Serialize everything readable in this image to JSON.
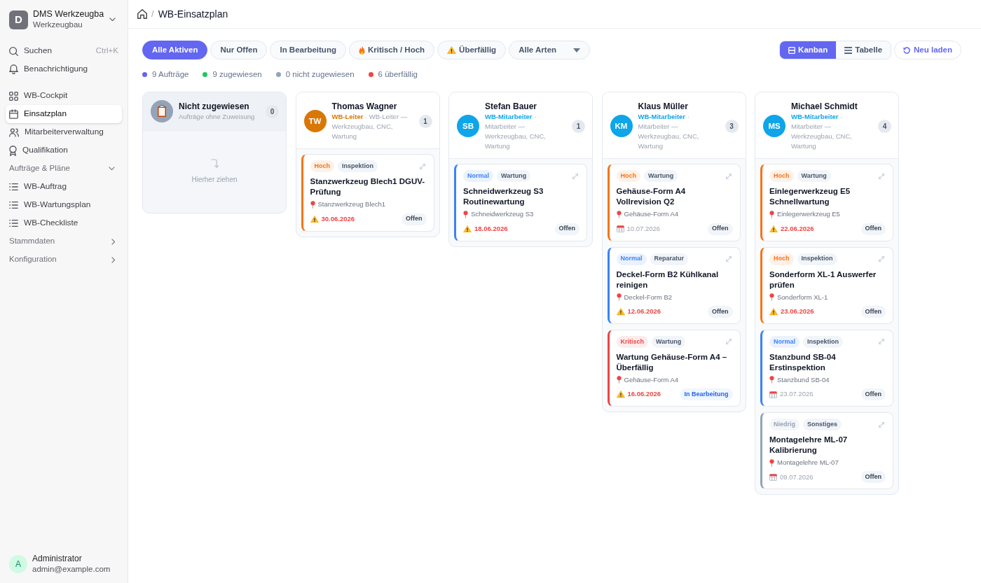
{
  "sidebar": {
    "workspace": {
      "initial": "D",
      "name": "DMS Werkzeugba",
      "subtitle": "Werkzeugbau"
    },
    "search": {
      "label": "Suchen",
      "shortcut": "Ctrl+K"
    },
    "notifications": {
      "label": "Benachrichtigung"
    },
    "nav": [
      {
        "kind": "link",
        "label": "WB-Cockpit",
        "selected": false
      },
      {
        "kind": "link",
        "label": "Einsatzplan",
        "selected": true
      },
      {
        "kind": "link",
        "label": "Mitarbeiterverwaltung",
        "selected": false
      },
      {
        "kind": "link",
        "label": "Qualifikation",
        "selected": false
      },
      {
        "kind": "group",
        "label": "Aufträge & Pläne",
        "expanded": true,
        "children": [
          {
            "kind": "link",
            "label": "WB-Auftrag",
            "selected": false
          },
          {
            "kind": "link",
            "label": "WB-Wartungsplan",
            "selected": false
          },
          {
            "kind": "link",
            "label": "WB-Checkliste",
            "selected": false
          }
        ]
      },
      {
        "kind": "group",
        "label": "Stammdaten",
        "expanded": false
      },
      {
        "kind": "group",
        "label": "Konfiguration",
        "expanded": false
      }
    ],
    "user": {
      "initial": "A",
      "name": "Administrator",
      "email": "admin@example.com"
    }
  },
  "breadcrumb": {
    "separator": "/",
    "current": "WB-Einsatzplan"
  },
  "filters": [
    {
      "label": "Alle Aktiven",
      "selected": true
    },
    {
      "label": "Nur Offen",
      "selected": false
    },
    {
      "label": "In Bearbeitung",
      "selected": false
    },
    {
      "label": "Kritisch / Hoch",
      "selected": false
    },
    {
      "label": "Überfällig",
      "selected": false
    }
  ],
  "type_filter": {
    "value": "Alle Arten"
  },
  "views": [
    {
      "label": "Kanban",
      "selected": true
    },
    {
      "label": "Tabelle",
      "selected": false
    }
  ],
  "reload": {
    "label": "Neu laden"
  },
  "stats": [
    {
      "text": "9 Aufträge",
      "color": "#6366f1"
    },
    {
      "text": "9 zugewiesen",
      "color": "#22c55e"
    },
    {
      "text": "0 nicht zugewiesen",
      "color": "#94a3b8"
    },
    {
      "text": "6 überfällig",
      "color": "#ef4444"
    }
  ],
  "columns": [
    {
      "kind": "unassigned",
      "title": "Nicht zugewiesen",
      "subtitle": "Aufträge ohne Zuweisung",
      "count": "0",
      "empty_hint": "Hierher ziehen"
    },
    {
      "kind": "person",
      "initials": "TW",
      "color": "#d97706",
      "name": "Thomas Wagner",
      "role": "**WB-Leiter** · WB-Leiter — Werkzeugbau, CNC, Wartung",
      "count": "1",
      "cards": [
        {
          "priority": "Hoch",
          "color": "#f97316",
          "type": "Inspektion",
          "title": "Stanzwerkzeug Blech1 DGUV-Prüfung",
          "location": "Stanzwerkzeug Blech1",
          "date": "30.06.2026",
          "overdue": true,
          "status": {
            "label": "Offen",
            "kind": "open"
          }
        }
      ]
    },
    {
      "kind": "person",
      "initials": "SB",
      "color": "#0ea5e9",
      "name": "Stefan Bauer",
      "role": "**WB-Mitarbeiter** · Mitarbeiter — Werkzeugbau, CNC, Wartung",
      "count": "1",
      "cards": [
        {
          "priority": "Normal",
          "color": "#3b82f6",
          "type": "Wartung",
          "title": "Schneidwerkzeug S3 Routinewartung",
          "location": "Schneidwerkzeug S3",
          "date": "18.06.2026",
          "overdue": true,
          "status": {
            "label": "Offen",
            "kind": "open"
          }
        }
      ]
    },
    {
      "kind": "person",
      "initials": "KM",
      "color": "#0ea5e9",
      "name": "Klaus Müller",
      "role": "**WB-Mitarbeiter** · Mitarbeiter — Werkzeugbau, CNC, Wartung",
      "count": "3",
      "cards": [
        {
          "priority": "Hoch",
          "color": "#f97316",
          "type": "Wartung",
          "title": "Gehäuse-Form A4 Vollrevision Q2",
          "location": "Gehäuse-Form A4",
          "date": "10.07.2026",
          "overdue": false,
          "status": {
            "label": "Offen",
            "kind": "open"
          }
        },
        {
          "priority": "Normal",
          "color": "#3b82f6",
          "type": "Reparatur",
          "title": "Deckel-Form B2 Kühlkanal reinigen",
          "location": "Deckel-Form B2",
          "date": "12.06.2026",
          "overdue": true,
          "status": {
            "label": "Offen",
            "kind": "open"
          }
        },
        {
          "priority": "Kritisch",
          "color": "#ef4444",
          "type": "Wartung",
          "title": "Wartung Gehäuse-Form A4 – Überfällig",
          "location": "Gehäuse-Form A4",
          "date": "16.06.2026",
          "overdue": true,
          "status": {
            "label": "In Bearbeitung",
            "kind": "in_progress"
          }
        }
      ]
    },
    {
      "kind": "person",
      "initials": "MS",
      "color": "#0ea5e9",
      "name": "Michael Schmidt",
      "role": "**WB-Mitarbeiter** · Mitarbeiter — Werkzeugbau, CNC, Wartung",
      "count": "4",
      "cards": [
        {
          "priority": "Hoch",
          "color": "#f97316",
          "type": "Wartung",
          "title": "Einlegerwerkzeug E5 Schnellwartung",
          "location": "Einlegerwerkzeug E5",
          "date": "22.06.2026",
          "overdue": true,
          "status": {
            "label": "Offen",
            "kind": "open"
          }
        },
        {
          "priority": "Hoch",
          "color": "#f97316",
          "type": "Inspektion",
          "title": "Sonderform XL-1 Auswerfer prüfen",
          "location": "Sonderform XL-1",
          "date": "23.06.2026",
          "overdue": true,
          "status": {
            "label": "Offen",
            "kind": "open"
          }
        },
        {
          "priority": "Normal",
          "color": "#3b82f6",
          "type": "Inspektion",
          "title": "Stanzbund SB-04 Erstinspektion",
          "location": "Stanzbund SB-04",
          "date": "23.07.2026",
          "overdue": false,
          "status": {
            "label": "Offen",
            "kind": "open"
          }
        },
        {
          "priority": "Niedrig",
          "color": "#94a3b8",
          "type": "Sonstiges",
          "title": "Montagelehre ML-07 Kalibrierung",
          "location": "Montagelehre ML-07",
          "date": "09.07.2026",
          "overdue": false,
          "status": {
            "label": "Offen",
            "kind": "open"
          }
        }
      ]
    }
  ]
}
